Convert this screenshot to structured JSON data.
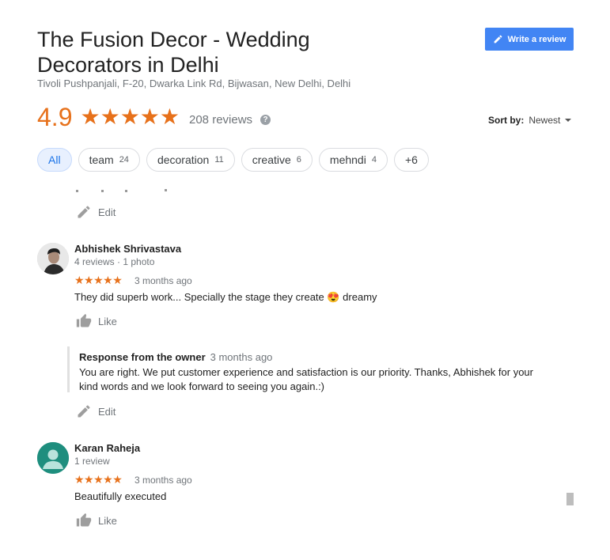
{
  "business": {
    "title_line1": "The Fusion Decor - Wedding",
    "title_line2": "Decorators in Delhi",
    "address": "Tivoli Pushpanjali, F-20, Dwarka Link Rd, Bijwasan, New Delhi, Delhi",
    "rating": "4.9",
    "stars": "★★★★★",
    "review_count": "208 reviews"
  },
  "write_review_label": "Write a review",
  "sort": {
    "label": "Sort by:",
    "value": "Newest"
  },
  "chips": [
    {
      "label": "All",
      "count": ""
    },
    {
      "label": "team",
      "count": "24"
    },
    {
      "label": "decoration",
      "count": "11"
    },
    {
      "label": "creative",
      "count": "6"
    },
    {
      "label": "mehndi",
      "count": "4"
    },
    {
      "label": "+6",
      "count": ""
    }
  ],
  "edit_label": "Edit",
  "like_label": "Like",
  "reviews": [
    {
      "name": "Abhishek Shrivastava",
      "meta": "4 reviews · 1 photo",
      "stars": "★★★★★",
      "time": "3 months ago",
      "text": "They did superb work... Specially the stage they create 😍 dreamy",
      "owner_label": "Response from the owner",
      "owner_time": "3 months ago",
      "owner_text": "You are right. We put customer experience and satisfaction is our priority. Thanks, Abhishek for your kind words and we look forward to seeing you again.:)"
    },
    {
      "name": "Karan Raheja",
      "meta": "1 review",
      "stars": "★★★★★",
      "time": "3 months ago",
      "text": "Beautifully executed"
    }
  ],
  "colors": {
    "accent": "#e7711b",
    "button": "#4285f4",
    "chip_active": "#e8f0fe",
    "avatar2": "#1e8e7e"
  }
}
